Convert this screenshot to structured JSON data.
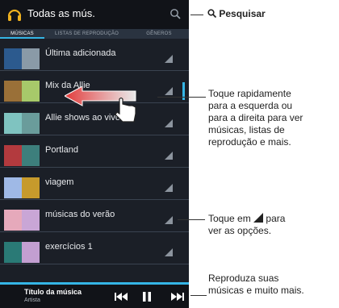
{
  "app": {
    "title": "Todas as mús."
  },
  "tabs": {
    "musicas": "MÚSICAS",
    "listas": "LISTAS DE REPRODUÇÃO",
    "generos": "GÊNEROS"
  },
  "list": [
    {
      "label": "Última adicionada",
      "c1": "#2c5a8e",
      "c2": "#8a9aa7"
    },
    {
      "label": "Mix da Allie",
      "c1": "#9a7038",
      "c2": "#a7c96a"
    },
    {
      "label": "Allie shows ao vivo",
      "c1": "#7fc3c0",
      "c2": "#6a9c9b"
    },
    {
      "label": "Portland",
      "c1": "#b33a3e",
      "c2": "#3d7f7c"
    },
    {
      "label": "viagem",
      "c1": "#9fb9e6",
      "c2": "#c69a2c"
    },
    {
      "label": "músicas do verão",
      "c1": "#e6a9bb",
      "c2": "#c9a6d6"
    },
    {
      "label": "exercícios 1",
      "c1": "#2a7a76",
      "c2": "#c39fd1"
    }
  ],
  "player": {
    "title": "Título da música",
    "artist": "Artista"
  },
  "callouts": {
    "search": "Pesquisar",
    "swipe": [
      "Toque rapidamente",
      "para a esquerda ou",
      "para a direita para ver",
      "músicas, listas de",
      "reprodução e mais."
    ],
    "options": [
      "Toque em",
      "para",
      "ver as opções."
    ],
    "play": [
      "Reproduza suas",
      "músicas e muito mais."
    ]
  },
  "colors": {
    "accent": "#35b5e5",
    "background": "#1b1f27",
    "swipe_arrow": "#e23a3a"
  }
}
